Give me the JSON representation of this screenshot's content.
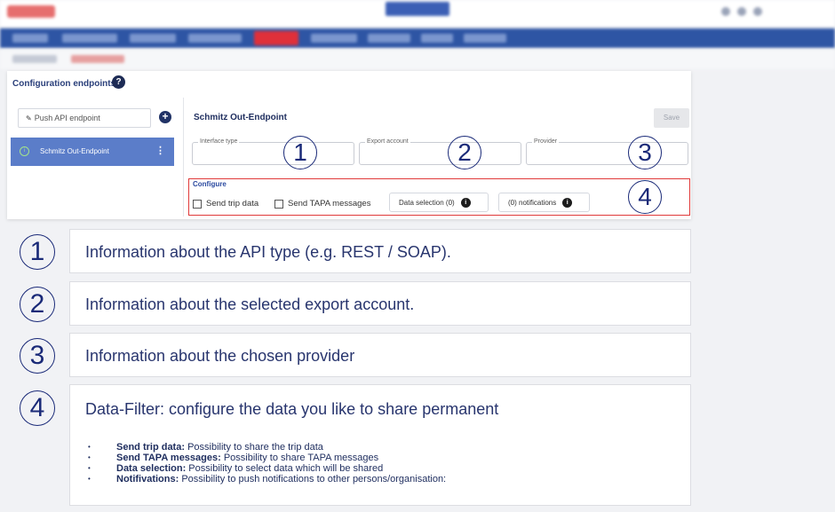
{
  "screenshot": {
    "config_title": "Configuration endpoints",
    "help_icon": "?",
    "push_input_placeholder": "Push API endpoint",
    "add_icon": "+",
    "endpoint_item": "Schmitz Out-Endpoint",
    "endpoint_title": "Schmitz Out-Endpoint",
    "save_label": "Save",
    "fields": {
      "interface_type": "Interface type",
      "export_account": "Export account",
      "provider": "Provider"
    },
    "configure_label": "Configure",
    "send_trip_data": "Send trip data",
    "send_tapa": "Send TAPA messages",
    "data_selection": "Data selection (0)",
    "notifications": "(0) notifications"
  },
  "markers": [
    "1",
    "2",
    "3",
    "4"
  ],
  "info": [
    {
      "num": "1",
      "text": "Information about the API type (e.g. REST / SOAP)."
    },
    {
      "num": "2",
      "text": "Information about the selected export account."
    },
    {
      "num": "3",
      "text": "Information about the chosen provider"
    },
    {
      "num": "4",
      "text": "Data-Filter: configure the data you like to share permanent"
    }
  ],
  "bullets": [
    {
      "term": "Send trip data:",
      "desc": " Possibility to share the trip data"
    },
    {
      "term": "Send TAPA messages:",
      "desc": " Possibility to share TAPA messages"
    },
    {
      "term": "Data selection:",
      "desc": " Possibility to select data which will be shared"
    },
    {
      "term": "Notifivations:",
      "desc": " Possibility to push notifications to other persons/organisation:"
    }
  ],
  "colors": {
    "accent": "#1a2a78",
    "highlight_border": "#e03a3a",
    "selected_item": "#5b7dc9",
    "nav_bar": "#2e55a4"
  }
}
